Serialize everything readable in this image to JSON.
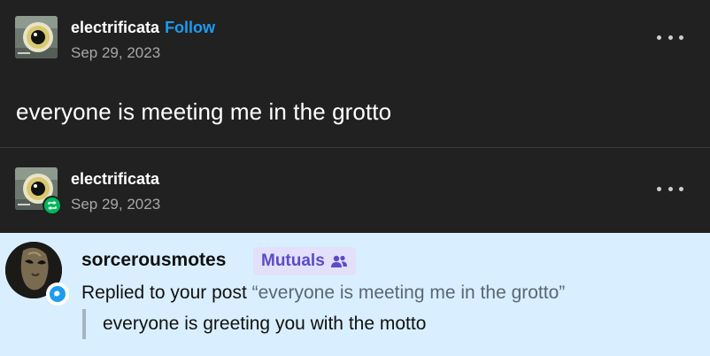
{
  "post": {
    "username": "electrificata",
    "follow_label": "Follow",
    "date": "Sep 29, 2023",
    "text": "everyone is meeting me in the grotto",
    "more_icon": "ellipsis-icon"
  },
  "reblog": {
    "username": "electrificata",
    "date": "Sep 29, 2023",
    "badge_icon": "reblog-icon",
    "badge_color": "#00b85c"
  },
  "reply": {
    "username": "sorcerousmotes",
    "badge_label": "Mutuals",
    "badge_icon": "people-icon",
    "replied_prefix": "Replied to your post ",
    "quoted_post": "“everyone is meeting me in the grotto”",
    "text": "everyone is greeting you with the motto",
    "background": "#d9efff",
    "reply_icon": "speech-bubble-icon"
  },
  "colors": {
    "background": "#212121",
    "link": "#1d9bf0",
    "mutuals_text": "#5b4bc7",
    "mutuals_bg": "#e3e0fb"
  }
}
